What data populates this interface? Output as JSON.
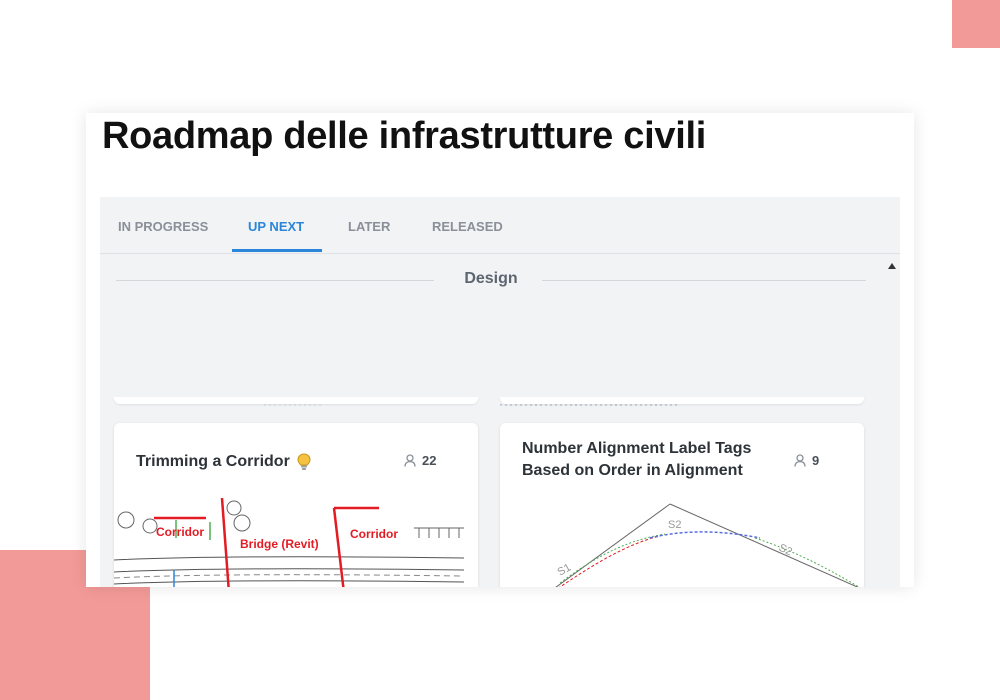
{
  "page": {
    "title": "Roadmap delle infrastrutture civili"
  },
  "tabs": [
    {
      "label": "IN PROGRESS",
      "active": false
    },
    {
      "label": "UP NEXT",
      "active": true
    },
    {
      "label": "LATER",
      "active": false
    },
    {
      "label": "RELEASED",
      "active": false
    }
  ],
  "section": {
    "title": "Design"
  },
  "cards": [
    {
      "title": "Trimming a Corridor",
      "votes": "22",
      "icon": "lightbulb-icon",
      "image_labels": [
        "Corridor",
        "Bridge (Revit)",
        "Corridor"
      ]
    },
    {
      "title": "Number Alignment Label Tags Based on Order in Alignment",
      "votes": "9",
      "image_labels": [
        "S1",
        "S2",
        "S2"
      ]
    }
  ],
  "colors": {
    "accent": "#2b86d9",
    "decoration": "#f29a98",
    "panel_bg": "#f2f3f5",
    "annotation_red": "#e31b23"
  }
}
